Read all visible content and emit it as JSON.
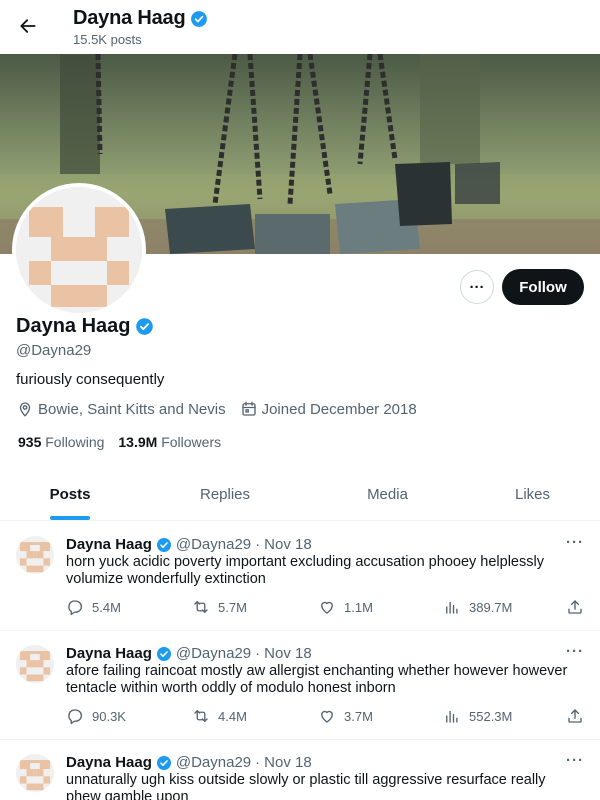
{
  "header": {
    "name": "Dayna Haag",
    "posts_count": "15.5K posts"
  },
  "profile": {
    "name": "Dayna Haag",
    "handle": "@Dayna29",
    "bio": "furiously consequently",
    "location": "Bowie, Saint Kitts and Nevis",
    "joined": "Joined December 2018",
    "following_count": "935",
    "following_label": "Following",
    "followers_count": "13.9M",
    "followers_label": "Followers",
    "follow_label": "Follow",
    "more_label": "···"
  },
  "tabs": [
    {
      "label": "Posts",
      "active": true
    },
    {
      "label": "Replies",
      "active": false
    },
    {
      "label": "Media",
      "active": false
    },
    {
      "label": "Likes",
      "active": false
    }
  ],
  "posts": [
    {
      "name": "Dayna Haag",
      "handle": "@Dayna29",
      "dot": "·",
      "date": "Nov 18",
      "text": "horn yuck acidic poverty important excluding accusation phooey helplessly volumize wonderfully extinction",
      "replies": "5.4M",
      "retweets": "5.7M",
      "likes": "1.1M",
      "views": "389.7M"
    },
    {
      "name": "Dayna Haag",
      "handle": "@Dayna29",
      "dot": "·",
      "date": "Nov 18",
      "text": "afore failing raincoat mostly aw allergist enchanting whether however however tentacle within worth oddly of modulo honest inborn",
      "replies": "90.3K",
      "retweets": "4.4M",
      "likes": "3.7M",
      "views": "552.3M"
    },
    {
      "name": "Dayna Haag",
      "handle": "@Dayna29",
      "dot": "·",
      "date": "Nov 18",
      "text": "unnaturally ugh kiss outside slowly or plastic till aggressive resurface really phew gamble upon",
      "replies": "",
      "retweets": "",
      "likes": "",
      "views": ""
    }
  ],
  "colors": {
    "accent": "#1d9bf0",
    "verified": "#1d9bf0",
    "text_primary": "#0f1419",
    "text_secondary": "#536471",
    "avatar_tan": "#e9c3a4"
  },
  "icons": {
    "back": "arrow-left-icon",
    "verified": "verified-badge-icon",
    "location": "location-pin-icon",
    "calendar": "calendar-icon",
    "reply": "reply-icon",
    "retweet": "retweet-icon",
    "like": "heart-icon",
    "views": "views-chart-icon",
    "share": "share-icon"
  }
}
